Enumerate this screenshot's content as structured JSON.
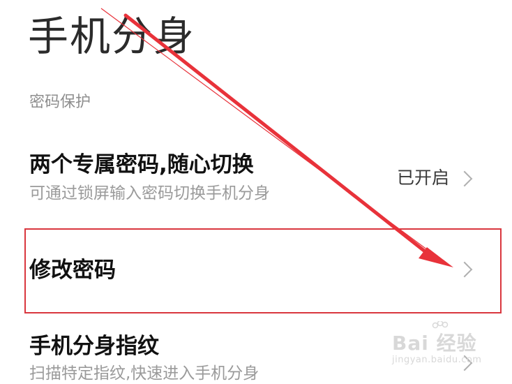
{
  "header": {
    "title": "手机分身"
  },
  "section": {
    "label": "密码保护"
  },
  "rows": [
    {
      "title": "两个专属密码,随心切换",
      "subtitle": "可通过锁屏输入密码切换手机分身",
      "value": "已开启"
    },
    {
      "title": "修改密码"
    },
    {
      "title": "手机分身指纹",
      "subtitle": "扫描特定指纹,快速进入手机分身"
    }
  ],
  "watermark": {
    "brand": "Bai  经验",
    "url": "jingyan.baidu.com"
  },
  "colors": {
    "highlight": "#d9363e",
    "arrow": "#e8323a"
  }
}
